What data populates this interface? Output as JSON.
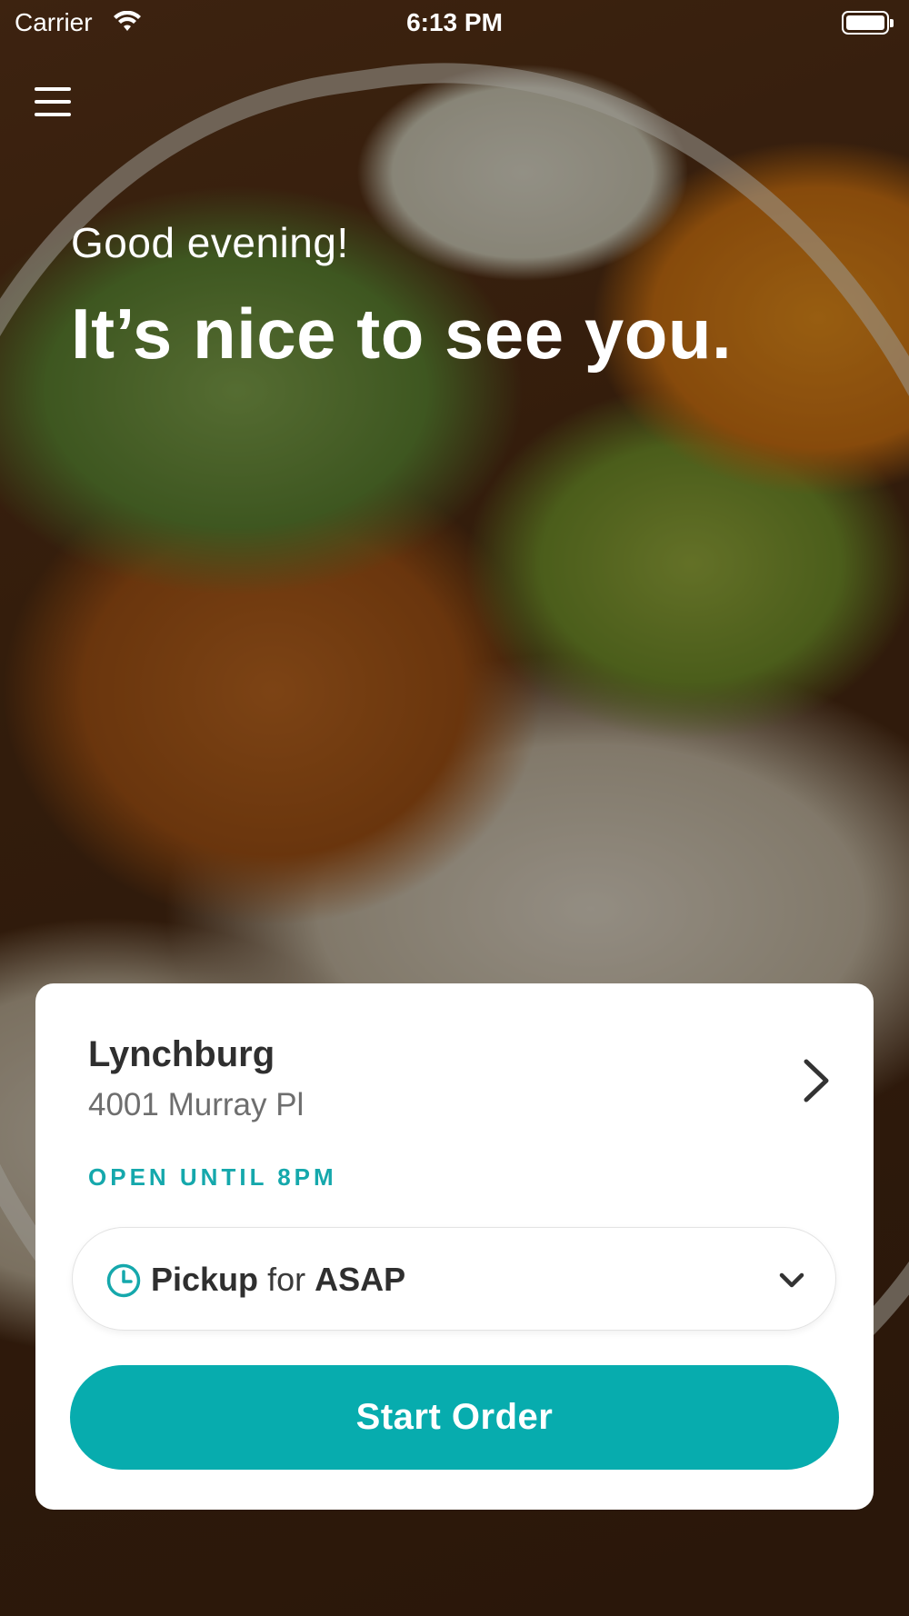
{
  "status_bar": {
    "carrier": "Carrier",
    "time": "6:13 PM"
  },
  "hero": {
    "greeting": "Good evening!",
    "headline": "It’s nice to see you."
  },
  "location": {
    "name": "Lynchburg",
    "address": "4001 Murray Pl",
    "hours": "OPEN UNTIL 8PM"
  },
  "order_mode": {
    "mode": "Pickup",
    "connector": "for",
    "time": "ASAP"
  },
  "actions": {
    "start_order": "Start Order"
  },
  "colors": {
    "accent": "#07acae",
    "hours_text": "#15a8ac",
    "card_bg": "#ffffff"
  },
  "icons": {
    "menu": "hamburger-menu-icon",
    "location_chevron": "chevron-right-icon",
    "clock": "clock-icon",
    "caret": "chevron-down-icon",
    "wifi": "wifi-icon",
    "battery": "battery-icon"
  }
}
